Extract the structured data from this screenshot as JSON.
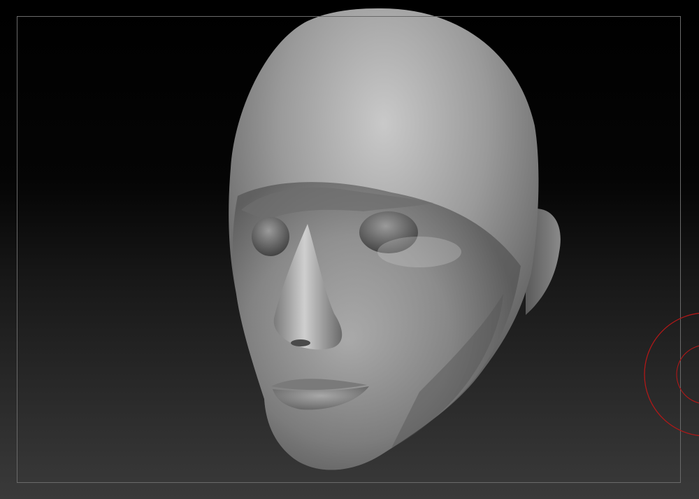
{
  "viewport": {
    "background_top": "#000000",
    "background_bottom": "#3a3a3a",
    "frame_color": "#6a6a6a"
  },
  "model": {
    "type": "sculpted-head",
    "material_color": "#8e8e8e"
  },
  "brush": {
    "icon": "brush-cursor-icon",
    "color": "#b01818"
  }
}
